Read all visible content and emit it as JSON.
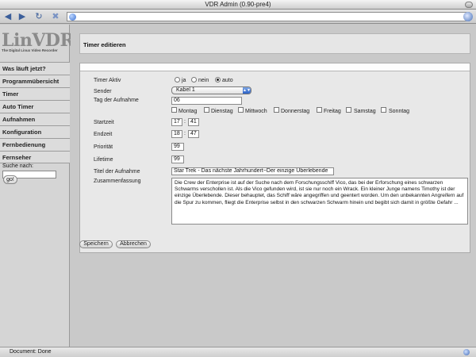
{
  "window": {
    "title": "VDR Admin (0.90-pre4)"
  },
  "sidebar": {
    "logo_text": "LinVDR",
    "logo_tagline": "The Digital Linux Video Recorder",
    "items": [
      {
        "label": "Was läuft jetzt?"
      },
      {
        "label": "Programmübersicht"
      },
      {
        "label": "Timer"
      },
      {
        "label": "Auto Timer"
      },
      {
        "label": "Aufnahmen"
      },
      {
        "label": "Konfiguration"
      },
      {
        "label": "Fernbedienung"
      },
      {
        "label": "Fernseher"
      }
    ],
    "search_label": "Suche nach:",
    "search_value": "",
    "search_button": "go!"
  },
  "page": {
    "title": "Timer editieren"
  },
  "form": {
    "timer_active": {
      "label": "Timer Aktiv",
      "options": [
        "ja",
        "nein",
        "auto"
      ],
      "selected": "auto"
    },
    "channel": {
      "label": "Sender",
      "value": "Kabel 1"
    },
    "day": {
      "label": "Tag der Aufnahme",
      "value": "06"
    },
    "weekdays": [
      "Montag",
      "Dienstag",
      "Mittwoch",
      "Donnerstag",
      "Freitag",
      "Samstag",
      "Sonntag"
    ],
    "start": {
      "label": "Startzeit",
      "hour": "17",
      "minute": "41",
      "separator": ":"
    },
    "end": {
      "label": "Endzeit",
      "hour": "18",
      "minute": "47",
      "separator": ":"
    },
    "priority": {
      "label": "Priorität",
      "value": "99"
    },
    "lifetime": {
      "label": "Lifetime",
      "value": "99"
    },
    "title": {
      "label": "Titel der Aufnahme",
      "value": "Star Trek - Das nächste Jahrhundert~Der einzige Überlebende"
    },
    "summary": {
      "label": "Zusammenfassung",
      "value": "Die Crew der Enterprise ist auf der Suche nach dem Forschungsschiff Vico, das bei der Erforschung eines schwarzen Schwarms verschollen ist. Als die Vico gefunden wird, ist sie nur noch ein Wrack. Ein kleiner Junge namens Timothy ist der einzige Überlebende. Dieser behauptet, das Schiff wäre angegriffen und geentert worden. Um den unbekannten Angreifern auf die Spur zu kommen, fliegt die Enterprise selbst in den schwarzen Schwarm hinein und begibt sich damit in größte Gefahr ..."
    }
  },
  "buttons": {
    "save": "Speichern",
    "cancel": "Abbrechen"
  },
  "status": {
    "text": "Document: Done"
  }
}
